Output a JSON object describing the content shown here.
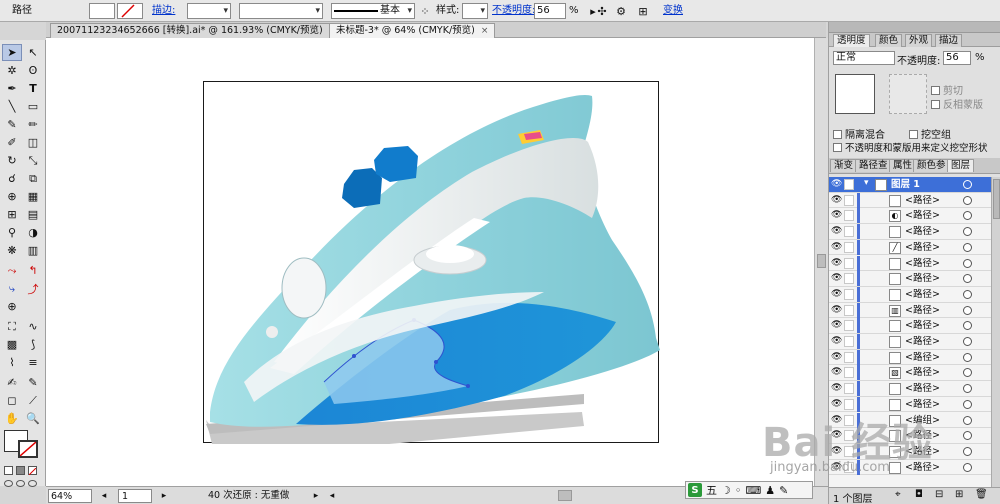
{
  "control_bar": {
    "object_type": "路径",
    "stroke_label": "描边:",
    "stroke_profile": "基本",
    "style_label": "样式:",
    "opacity_label": "不透明度:",
    "opacity_value": "56",
    "percent": "%",
    "transform_label": "变换"
  },
  "tabs": [
    {
      "label": "20071123234652666 [转换].ai* @ 161.93% (CMYK/预览)",
      "close": "×"
    },
    {
      "label": "未标题-3* @ 64% (CMYK/预览)",
      "close": "×"
    }
  ],
  "status": {
    "zoom": "64%",
    "page": "1",
    "undo_text": "40 次还原 : 无重做"
  },
  "panel": {
    "top_tabs": [
      "透明度",
      "颜色",
      "外观",
      "描边"
    ],
    "blend_mode": "正常",
    "opacity_label": "不透明度:",
    "opacity_value": "56",
    "percent": "%",
    "clip": "剪切",
    "invert_mask": "反相蒙版",
    "isolate_blending": "隔离混合",
    "knockout_group": "挖空组",
    "opacity_mask_text": "不透明度和蒙版用来定义挖空形状",
    "layer_tabs": [
      "渐变",
      "路径查",
      "属性",
      "颜色参",
      "图层"
    ],
    "top_layer": "图层 1",
    "layer_rows": [
      "<路径>",
      "<路径>",
      "<路径>",
      "<路径>",
      "<路径>",
      "<路径>",
      "<路径>",
      "<路径>",
      "<路径>",
      "<路径>",
      "<路径>",
      "<路径>",
      "<路径>",
      "<路径>",
      "<编组>",
      "<路径>",
      "<路径>",
      "<路径>"
    ],
    "layer_count": "1 个图层"
  },
  "ime": {
    "logo": "S",
    "mode": "五"
  },
  "watermark": {
    "brand": "Bai 经验",
    "url": "jingyan.baidu.com"
  },
  "colors": {
    "selection": "#3d6fd8",
    "iron_body": "#8ed3dc",
    "iron_blue": "#1f8ed8"
  }
}
